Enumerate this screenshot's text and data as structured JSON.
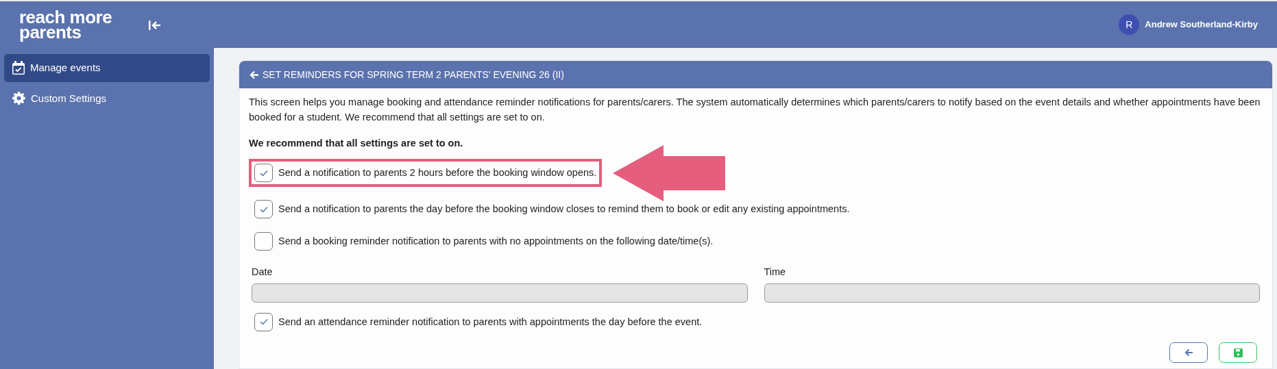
{
  "logo": {
    "lines": [
      "reach more",
      "parents"
    ]
  },
  "user": {
    "initial": "R",
    "name": "Andrew Southerland-Kirby"
  },
  "sidebar": {
    "items": [
      {
        "label": "Manage events",
        "selected": true
      },
      {
        "label": "Custom Settings",
        "selected": false
      }
    ]
  },
  "card": {
    "title": "SET REMINDERS FOR SPRING TERM 2 PARENTS' EVENING 26 (II)",
    "intro": "This screen helps you manage booking and attendance reminder notifications for parents/carers. The system automatically determines which parents/carers to notify based on the event details and whether appointments have been booked for a student. We recommend that all settings are set to on.",
    "recommendation": "We recommend that all settings are set to on.",
    "settings": [
      {
        "kind": "checkbox",
        "label": "Send a notification to parents 2 hours before the booking window opens.",
        "checked": true,
        "highlighted": true
      },
      {
        "kind": "checkbox",
        "label": "Send a notification to parents the day before the booking window closes to remind them to book or edit any existing appointments.",
        "checked": true,
        "highlighted": false
      },
      {
        "kind": "checkbox",
        "label": "Send a booking reminder notification to parents with no appointments on the following date/time(s).",
        "checked": false,
        "highlighted": false
      },
      {
        "kind": "fields",
        "fields": [
          {
            "label": "Date",
            "disabled": true
          },
          {
            "label": "Time",
            "disabled": true
          }
        ]
      },
      {
        "kind": "checkbox",
        "label": "Send an attendance reminder notification to parents with appointments the day before the event.",
        "checked": true,
        "highlighted": false
      }
    ],
    "buttons": [
      {
        "kind": "back"
      },
      {
        "kind": "save"
      }
    ]
  }
}
